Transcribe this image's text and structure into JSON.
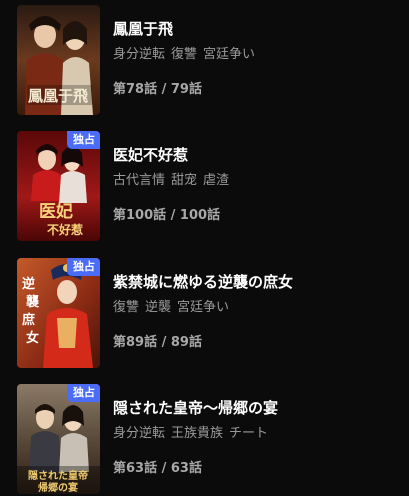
{
  "dramas": [
    {
      "title": "鳳凰于飛",
      "tags": [
        "身分逆転",
        "復讐",
        "宮廷争い"
      ],
      "episodes": "第78話 / 79話",
      "badge": "",
      "poster_text": "鳳凰于飛",
      "colors": {
        "bg": "#6b3a1e",
        "accent": "#c9a24a"
      }
    },
    {
      "title": "医妃不好惹",
      "tags": [
        "古代言情",
        "甜宠",
        "虐渣"
      ],
      "episodes": "第100話 / 100話",
      "badge": "独占",
      "poster_text": "医妃不好惹",
      "colors": {
        "bg": "#8a1010",
        "accent": "#f0c060"
      }
    },
    {
      "title": "紫禁城に燃ゆる逆襲の庶女",
      "tags": [
        "復讐",
        "逆襲",
        "宮廷争い"
      ],
      "episodes": "第89話 / 89話",
      "badge": "独占",
      "poster_text": "逆襲庶女",
      "colors": {
        "bg": "#9a3a1a",
        "accent": "#e6c08a"
      }
    },
    {
      "title": "隠された皇帝〜帰郷の宴",
      "tags": [
        "身分逆転",
        "王族貴族",
        "チート"
      ],
      "episodes": "第63話 / 63話",
      "badge": "独占",
      "poster_text": "隠された皇帝帰郷の宴",
      "colors": {
        "bg": "#5a4a3a",
        "accent": "#e0c070"
      }
    }
  ]
}
